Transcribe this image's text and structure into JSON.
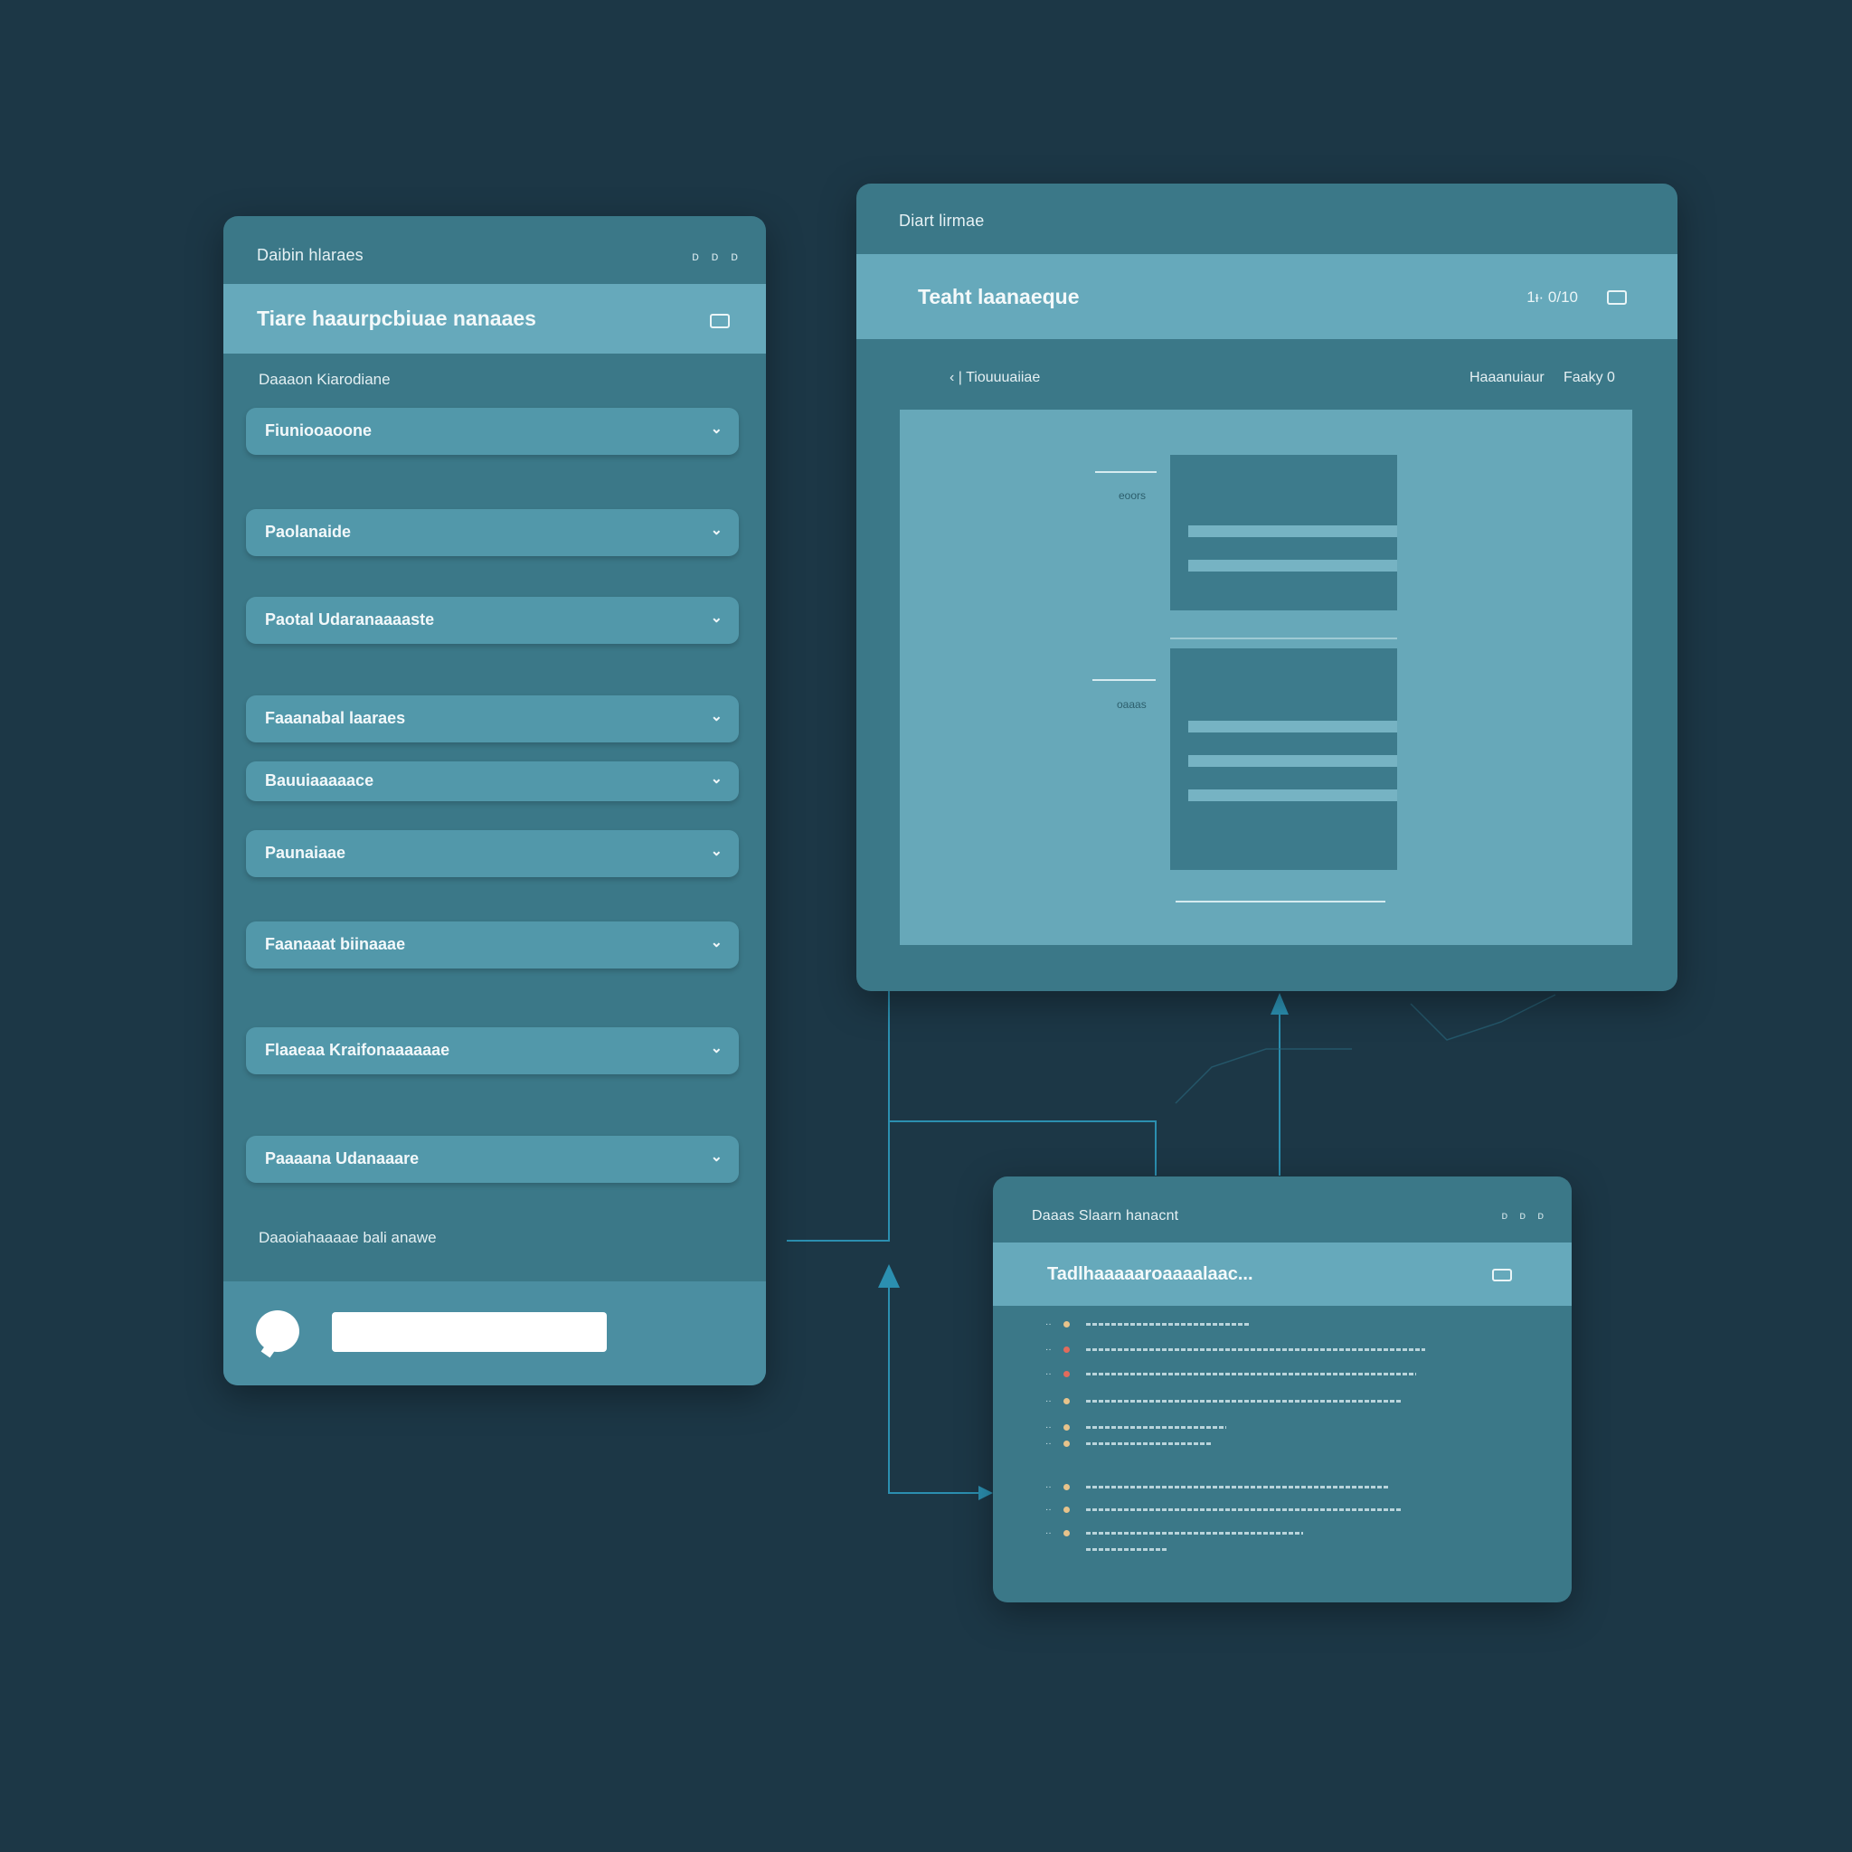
{
  "colors": {
    "background": "#1c3746",
    "panel": "#3b7888",
    "highlight": "#66a9bb",
    "accent": "#2a8fb0"
  },
  "left_panel": {
    "title": "Daibin hlaraes",
    "controls": "ᴅ ᴅ ᴅ",
    "header": "Tiare haaurpcbiuae nanaaes",
    "header_icon": "window-icon",
    "section_label": "Daaaon Kiarodiane",
    "dropdowns": [
      {
        "label": "Fiuniooaoone"
      },
      {
        "label": "Paolanaide"
      },
      {
        "label": "Paotal Udaranaaaaste"
      },
      {
        "label": "Faaanabal laaraes"
      },
      {
        "label": "Bauuiaaaaace"
      },
      {
        "label": "Paunaiaae"
      },
      {
        "label": "Faanaaat biinaaae"
      },
      {
        "label": "Flaaeaa Kraifonaaaaaae"
      },
      {
        "label": "Paaaana Udanaaare"
      }
    ],
    "footer_label": "Daaoiahaaaae bali anawe",
    "chat_input_placeholder": ""
  },
  "right_top": {
    "title": "Diart lirmae",
    "header": "Teaht  laanaeque",
    "counter": "1ᵻ·  0/10",
    "header_icon": "window-icon",
    "breadcrumb": "‹ | Tiouuuaiiae",
    "sub_right_1": "Haaanuiaur",
    "sub_right_2": "Faaky 0",
    "section_labels": [
      "eoors",
      "oaaas"
    ]
  },
  "right_bottom": {
    "title": "Daaas Slaarn hanacnt",
    "controls": "ᴅ ᴅ ᴅ",
    "header": "Tadlhaaaaaroaaaalaac...",
    "header_icon": "window-icon",
    "log_rows": [
      {
        "num": "··",
        "dot": "normal"
      },
      {
        "num": "··",
        "dot": "red"
      },
      {
        "num": "··",
        "dot": "red"
      },
      {
        "num": "··",
        "dot": "normal"
      },
      {
        "num": "··",
        "dot": "normal"
      },
      {
        "num": "··",
        "dot": "normal"
      },
      {
        "num": "··",
        "dot": "normal"
      },
      {
        "num": "··",
        "dot": "normal"
      },
      {
        "num": "··",
        "dot": "normal"
      }
    ]
  }
}
